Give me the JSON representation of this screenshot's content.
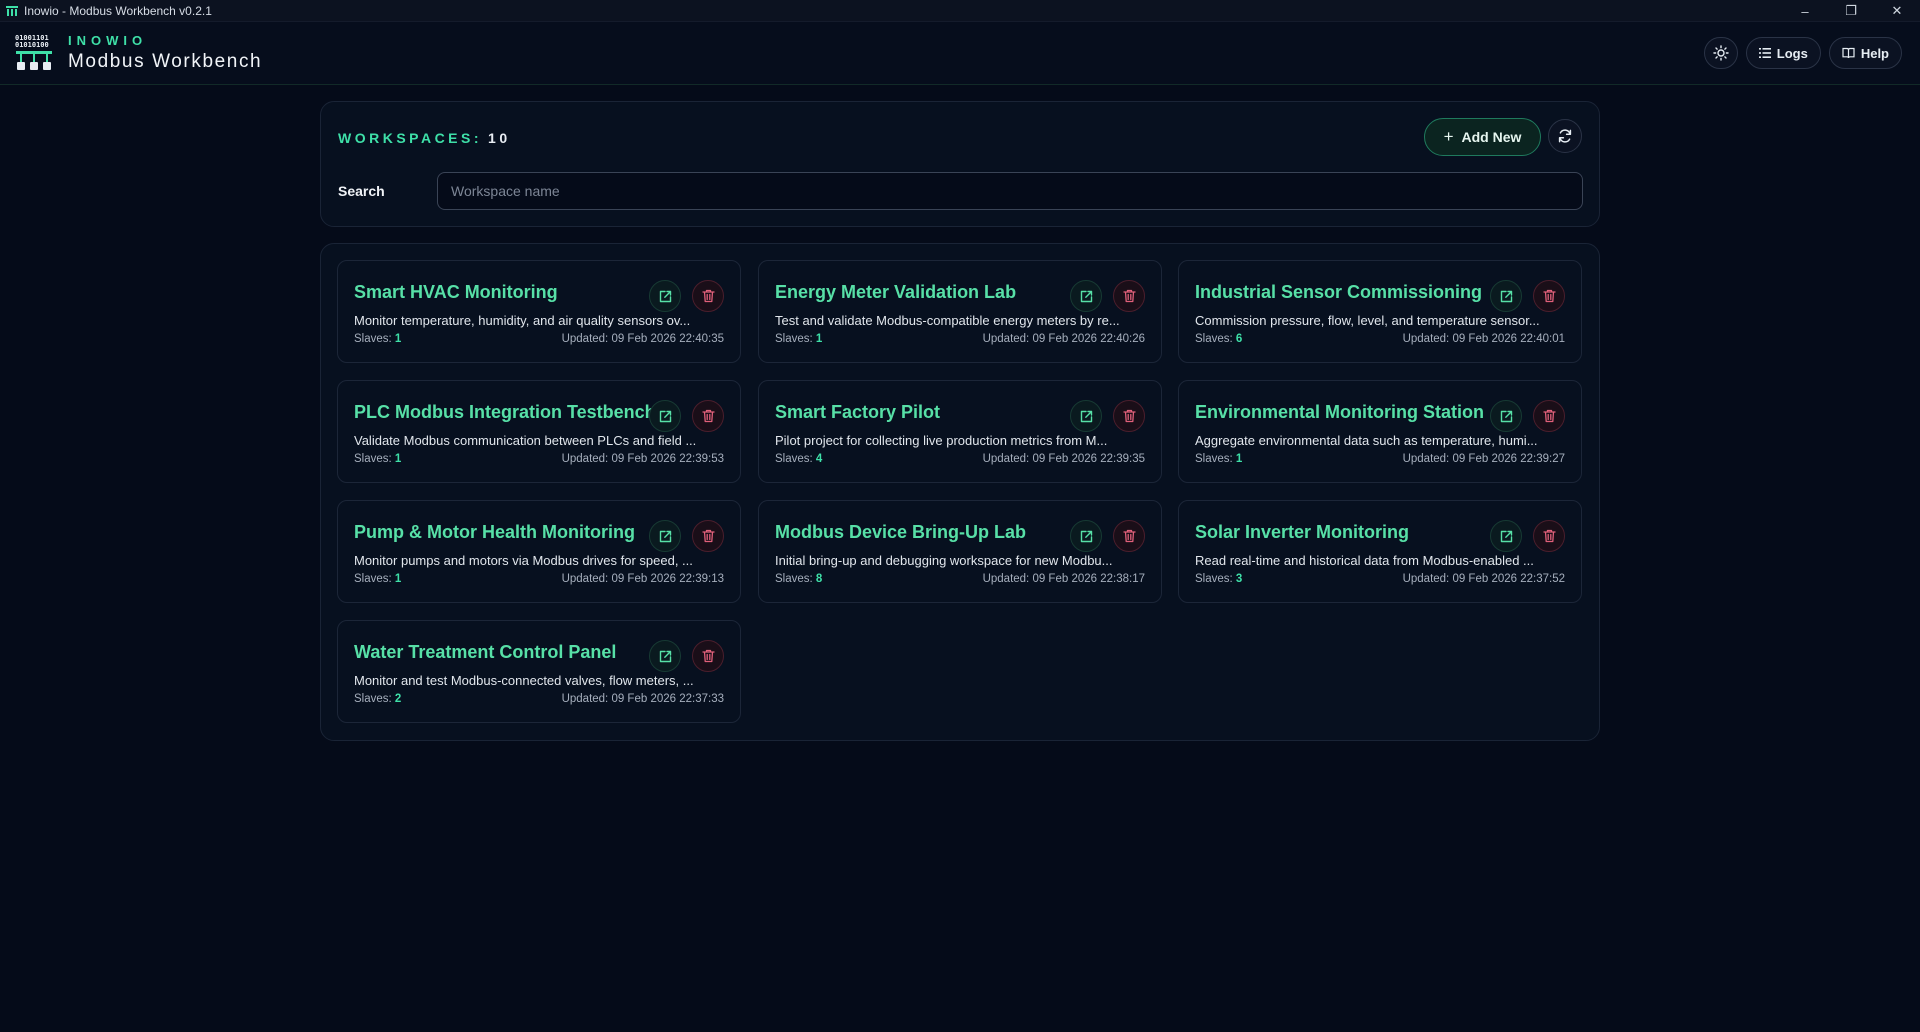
{
  "window": {
    "title": "Inowio - Modbus Workbench v0.2.1",
    "controls": [
      "–",
      "❐",
      "✕"
    ]
  },
  "header": {
    "brand_small": "INOWIO",
    "brand_big": "Modbus Workbench",
    "theme_icon": "sun-icon",
    "logs_label": "Logs",
    "help_label": "Help"
  },
  "workspaces": {
    "title": "WORKSPACES:",
    "count": "10",
    "add_new_label": "Add New",
    "search_label": "Search",
    "search_placeholder": "Workspace name",
    "search_value": ""
  },
  "colors": {
    "accent": "#3ee0a8",
    "title": "#57e0a7",
    "danger": "#e0607a",
    "background": "#050b19"
  },
  "cards": [
    {
      "title": "Smart HVAC Monitoring",
      "desc": "Monitor temperature, humidity, and air quality sensors ov...",
      "slaves_label": "Slaves:",
      "slaves": "1",
      "updated": "Updated: 09 Feb 2026 22:40:35"
    },
    {
      "title": "Energy Meter Validation Lab",
      "desc": "Test and validate Modbus-compatible energy meters by re...",
      "slaves_label": "Slaves:",
      "slaves": "1",
      "updated": "Updated: 09 Feb 2026 22:40:26"
    },
    {
      "title": "Industrial Sensor Commissioning",
      "desc": "Commission pressure, flow, level, and temperature sensor...",
      "slaves_label": "Slaves:",
      "slaves": "6",
      "updated": "Updated: 09 Feb 2026 22:40:01"
    },
    {
      "title": "PLC Modbus Integration Testbench",
      "desc": "Validate Modbus communication between PLCs and field ...",
      "slaves_label": "Slaves:",
      "slaves": "1",
      "updated": "Updated: 09 Feb 2026 22:39:53"
    },
    {
      "title": "Smart Factory Pilot",
      "desc": "Pilot project for collecting live production metrics from M...",
      "slaves_label": "Slaves:",
      "slaves": "4",
      "updated": "Updated: 09 Feb 2026 22:39:35"
    },
    {
      "title": "Environmental Monitoring Station",
      "desc": "Aggregate environmental data such as temperature, humi...",
      "slaves_label": "Slaves:",
      "slaves": "1",
      "updated": "Updated: 09 Feb 2026 22:39:27"
    },
    {
      "title": "Pump & Motor Health Monitoring",
      "desc": "Monitor pumps and motors via Modbus drives for speed, ...",
      "slaves_label": "Slaves:",
      "slaves": "1",
      "updated": "Updated: 09 Feb 2026 22:39:13"
    },
    {
      "title": "Modbus Device Bring-Up Lab",
      "desc": "Initial bring-up and debugging workspace for new Modbu...",
      "slaves_label": "Slaves:",
      "slaves": "8",
      "updated": "Updated: 09 Feb 2026 22:38:17"
    },
    {
      "title": "Solar Inverter Monitoring",
      "desc": "Read real-time and historical data from Modbus-enabled ...",
      "slaves_label": "Slaves:",
      "slaves": "3",
      "updated": "Updated: 09 Feb 2026 22:37:52"
    },
    {
      "title": "Water Treatment Control Panel",
      "desc": "Monitor and test Modbus-connected valves, flow meters, ...",
      "slaves_label": "Slaves:",
      "slaves": "2",
      "updated": "Updated: 09 Feb 2026 22:37:33"
    }
  ]
}
